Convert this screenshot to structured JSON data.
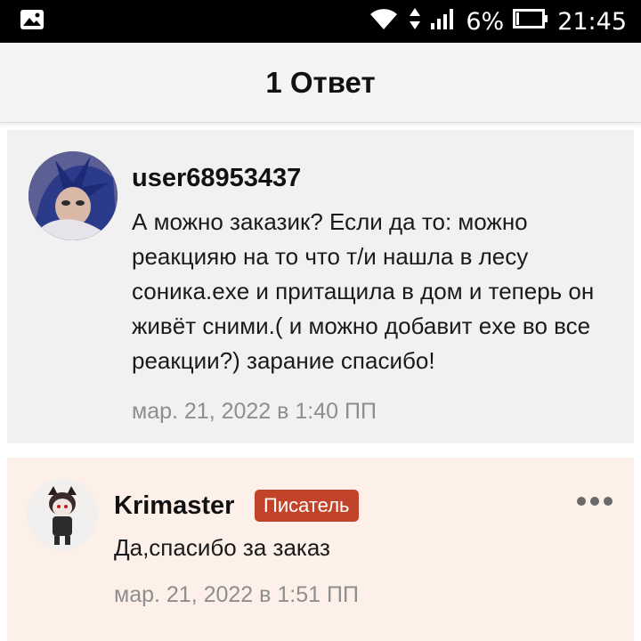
{
  "status_bar": {
    "battery": "6%",
    "time": "21:45",
    "icons": [
      "gallery-icon",
      "wifi-icon",
      "data-transfer-icon",
      "signal-icon",
      "battery-icon"
    ]
  },
  "header": {
    "title": "1 Ответ"
  },
  "comments": [
    {
      "username": "user68953437",
      "body": "А можно заказик? Если да то: можно реакцияю на то что т/и нашла в лесу соника.exe и притащила в дом и теперь он живёт сними.( и можно добавит exe во все реакции?) зарание спасибо!",
      "timestamp": "мар. 21, 2022 в 1:40 ПП"
    },
    {
      "username": "Krimaster",
      "badge": "Писатель",
      "body": "Да,спасибо за заказ",
      "timestamp": "мар. 21, 2022 в 1:51 ПП"
    }
  ],
  "colors": {
    "badge": "#c0432a",
    "reply_background": "#fdf0e9",
    "comment_background": "#f1f1f1"
  }
}
